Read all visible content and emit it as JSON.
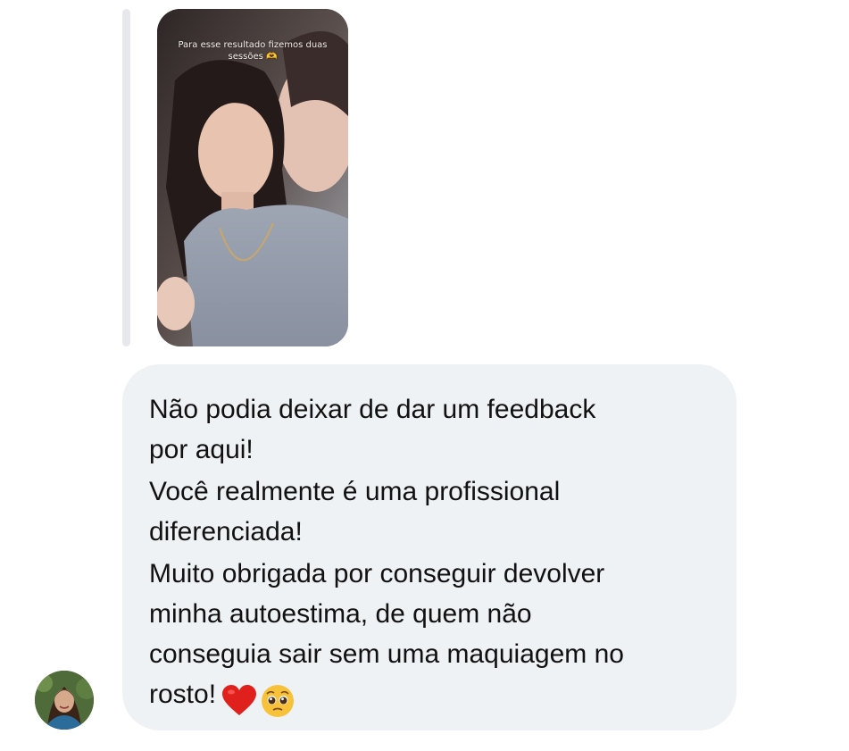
{
  "story_reply": {
    "caption_line1": "Para esse resultado fizemos duas",
    "caption_line2": "sessões 🫶"
  },
  "message": {
    "paragraphs": [
      [
        "Não podia deixar de dar um feedback",
        "por aqui!"
      ],
      [
        "Você realmente é uma profissional",
        "diferenciada!"
      ],
      [
        "Muito obrigada por conseguir devolver",
        "minha autoestima, de quem não",
        "conseguia sair sem uma maquiagem no",
        "rosto!"
      ]
    ],
    "emojis": [
      "red-heart-icon",
      "pleading-face-icon"
    ]
  },
  "sender": {
    "avatar": "profile-photo-woman"
  },
  "colors": {
    "bubble_background": "#eff2f5",
    "text": "#111111",
    "reply_bar": "#e6e8eb",
    "heart": "#e0201c",
    "emoji_face": "#f7c23a"
  }
}
